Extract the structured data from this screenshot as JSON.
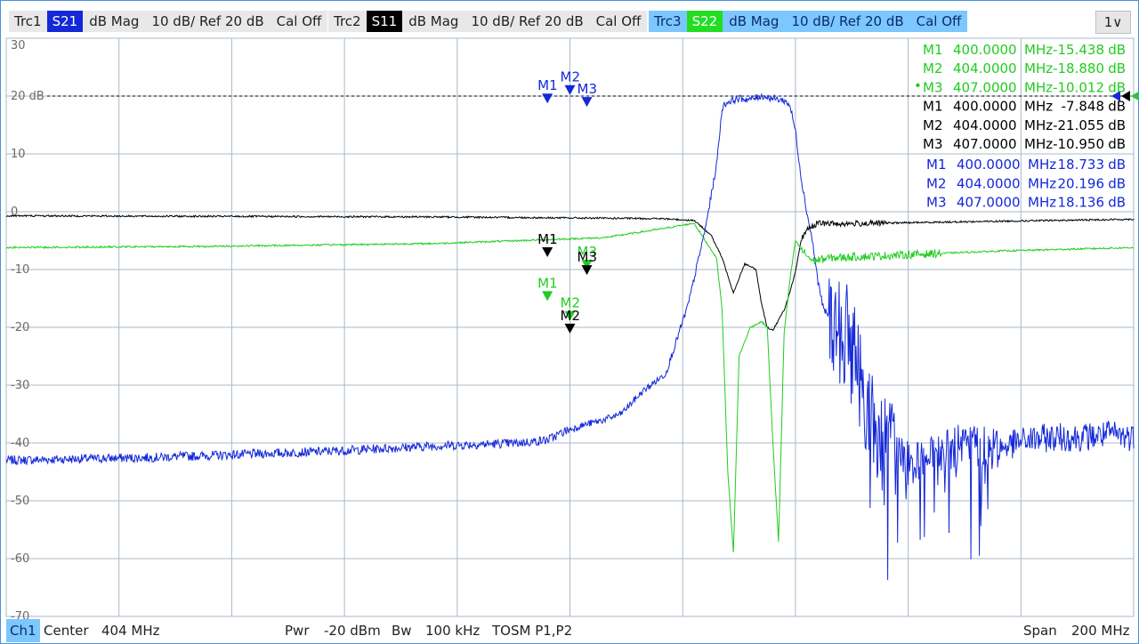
{
  "traces": [
    {
      "id": "trc1",
      "label": "Trc1",
      "param": "S21",
      "param_bg": "#1428d8",
      "format": "dB Mag",
      "scale": "10 dB/ Ref 20 dB",
      "cal": "Cal Off"
    },
    {
      "id": "trc2",
      "label": "Trc2",
      "param": "S11",
      "param_bg": "#000000",
      "format": "dB Mag",
      "scale": "10 dB/ Ref 20 dB",
      "cal": "Cal Off"
    },
    {
      "id": "trc3",
      "label": "Trc3",
      "param": "S22",
      "param_bg": "#22dd22",
      "format": "dB Mag",
      "scale": "10 dB/ Ref 20 dB",
      "cal": "Cal Off"
    }
  ],
  "menu_button": "1∨",
  "status": {
    "channel": "Ch1",
    "center_label": "Center",
    "center_value": "404 MHz",
    "pwr_label": "Pwr",
    "pwr_value": "-20 dBm",
    "bw_label": "Bw",
    "bw_value": "100 kHz",
    "cal_type": "TOSM P1,P2",
    "span_label": "Span",
    "span_value": "200 MHz"
  },
  "colors": {
    "s21": "#1428d8",
    "s11": "#000000",
    "s22": "#22cc22",
    "grid": "#aab8c8"
  },
  "chart_data": {
    "type": "line",
    "x_unit": "MHz",
    "xlim": [
      304,
      504
    ],
    "ylim": [
      -70,
      30
    ],
    "y_ticks": [
      "30",
      "20 dB",
      "10",
      "0",
      "-10",
      "-20",
      "-30",
      "-40",
      "-50",
      "-60",
      "-70"
    ],
    "ref_level_db": 20,
    "grid": true,
    "series": [
      {
        "name": "S21",
        "color": "#1428d8",
        "points": [
          [
            304,
            -43
          ],
          [
            330,
            -42.5
          ],
          [
            360,
            -41.5
          ],
          [
            380,
            -40.5
          ],
          [
            395,
            -40
          ],
          [
            400,
            -39.5
          ],
          [
            403,
            -38
          ],
          [
            406,
            -37
          ],
          [
            410,
            -36
          ],
          [
            413,
            -35
          ],
          [
            417,
            -31
          ],
          [
            421,
            -28
          ],
          [
            425,
            -16
          ],
          [
            428,
            -3
          ],
          [
            430,
            8
          ],
          [
            431,
            18
          ],
          [
            432,
            19
          ],
          [
            434,
            19.6
          ],
          [
            436,
            19.4
          ],
          [
            438,
            20
          ],
          [
            440,
            19.6
          ],
          [
            442,
            19.2
          ],
          [
            443,
            18.5
          ],
          [
            444,
            14
          ],
          [
            445,
            6
          ],
          [
            446,
            0
          ],
          [
            447,
            -5
          ],
          [
            448,
            -12
          ],
          [
            449,
            -17
          ],
          [
            450,
            -18
          ],
          [
            452,
            -21
          ],
          [
            454,
            -22
          ],
          [
            456,
            -31
          ],
          [
            458,
            -38
          ],
          [
            460,
            -40
          ],
          [
            463,
            -42
          ],
          [
            466,
            -44
          ],
          [
            470,
            -42
          ],
          [
            475,
            -40
          ],
          [
            480,
            -41
          ],
          [
            485,
            -39.5
          ],
          [
            490,
            -39
          ],
          [
            495,
            -39
          ],
          [
            500,
            -38.5
          ],
          [
            504,
            -39
          ]
        ]
      },
      {
        "name": "S11",
        "color": "#000000",
        "points": [
          [
            304,
            -0.7
          ],
          [
            340,
            -0.8
          ],
          [
            380,
            -0.9
          ],
          [
            420,
            -1.2
          ],
          [
            426,
            -1.5
          ],
          [
            429,
            -4
          ],
          [
            431,
            -8
          ],
          [
            433,
            -14
          ],
          [
            435,
            -9
          ],
          [
            437,
            -10
          ],
          [
            438,
            -16
          ],
          [
            439,
            -20
          ],
          [
            440,
            -20.5
          ],
          [
            442,
            -17
          ],
          [
            443,
            -14
          ],
          [
            444,
            -10.5
          ],
          [
            445,
            -5
          ],
          [
            446,
            -3
          ],
          [
            448,
            -2
          ],
          [
            452,
            -2.1
          ],
          [
            470,
            -1.8
          ],
          [
            504,
            -1.3
          ]
        ]
      },
      {
        "name": "S22",
        "color": "#22cc22",
        "points": [
          [
            304,
            -6.2
          ],
          [
            340,
            -6
          ],
          [
            380,
            -5.5
          ],
          [
            410,
            -4.5
          ],
          [
            420,
            -3
          ],
          [
            426,
            -2
          ],
          [
            430,
            -8
          ],
          [
            431,
            -17
          ],
          [
            432,
            -45
          ],
          [
            433,
            -59
          ],
          [
            434,
            -25
          ],
          [
            436,
            -20
          ],
          [
            438,
            -19
          ],
          [
            439,
            -20
          ],
          [
            440,
            -40
          ],
          [
            441,
            -57
          ],
          [
            442,
            -21
          ],
          [
            443,
            -12
          ],
          [
            444,
            -5
          ],
          [
            445,
            -6.5
          ],
          [
            447,
            -8.5
          ],
          [
            450,
            -8
          ],
          [
            460,
            -7.6
          ],
          [
            480,
            -6.8
          ],
          [
            504,
            -6.2
          ]
        ]
      }
    ],
    "markers": [
      {
        "trace": "S22",
        "name": "M1",
        "freq": "400.0000",
        "unit": "MHz",
        "value": "-15.438",
        "value_unit": "dB",
        "active": false
      },
      {
        "trace": "S22",
        "name": "M2",
        "freq": "404.0000",
        "unit": "MHz",
        "value": "-18.880",
        "value_unit": "dB",
        "active": false
      },
      {
        "trace": "S22",
        "name": "M3",
        "freq": "407.0000",
        "unit": "MHz",
        "value": "-10.012",
        "value_unit": "dB",
        "active": true
      },
      {
        "trace": "S11",
        "name": "M1",
        "freq": "400.0000",
        "unit": "MHz",
        "value": "-7.848",
        "value_unit": "dB",
        "active": false
      },
      {
        "trace": "S11",
        "name": "M2",
        "freq": "404.0000",
        "unit": "MHz",
        "value": "-21.055",
        "value_unit": "dB",
        "active": false
      },
      {
        "trace": "S11",
        "name": "M3",
        "freq": "407.0000",
        "unit": "MHz",
        "value": "-10.950",
        "value_unit": "dB",
        "active": false
      },
      {
        "trace": "S21",
        "name": "M1",
        "freq": "400.0000",
        "unit": "MHz",
        "value": "18.733",
        "value_unit": "dB",
        "active": false
      },
      {
        "trace": "S21",
        "name": "M2",
        "freq": "404.0000",
        "unit": "MHz",
        "value": "20.196",
        "value_unit": "dB",
        "active": false
      },
      {
        "trace": "S21",
        "name": "M3",
        "freq": "407.0000",
        "unit": "MHz",
        "value": "18.136",
        "value_unit": "dB",
        "active": false
      }
    ]
  }
}
